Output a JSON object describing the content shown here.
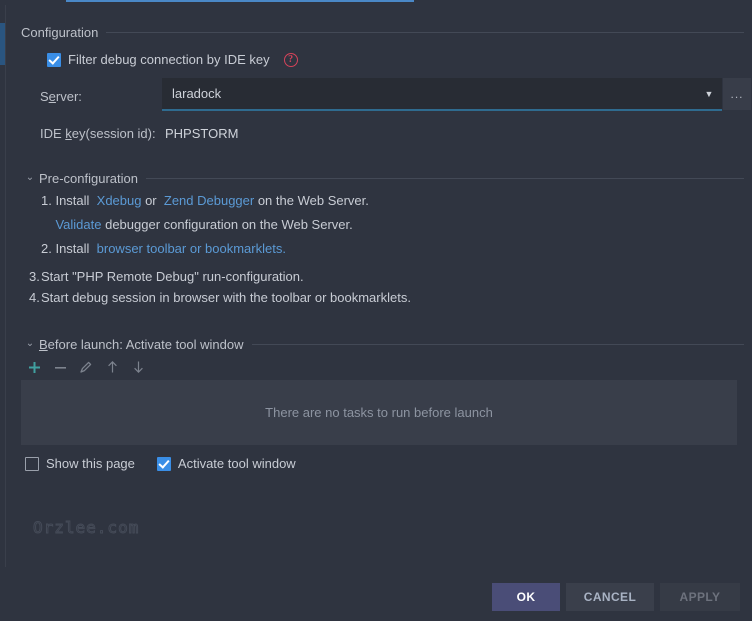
{
  "window": {
    "background_color": "#2f3440",
    "accent_blue": "#4a88c7",
    "link_color": "#5b9ad5"
  },
  "configuration_section": {
    "title": "Configuration",
    "filter_checkbox": {
      "label": "Filter debug connection by IDE key",
      "checked": true
    },
    "help_icon": "?",
    "server": {
      "label": "Server:",
      "label_underline_char": "e",
      "value": "laradock",
      "dropdown_arrow": "▼",
      "browse_button_label": "..."
    },
    "ide_key": {
      "label_part1": "IDE ",
      "label_underline_char": "k",
      "label_part2": "ey(session id):",
      "value": "PHPSTORM"
    }
  },
  "preconfiguration_section": {
    "title": "Pre-configuration",
    "chevron": "⌄",
    "lines": [
      {
        "number": "1.",
        "segments": [
          {
            "text": "Install ",
            "link": false
          },
          {
            "text": " Xdebug",
            "link": true
          },
          {
            "text": " or ",
            "link": false
          },
          {
            "text": " Zend Debugger",
            "link": true
          },
          {
            "text": " on the Web Server.",
            "link": false
          }
        ]
      },
      {
        "number": "",
        "segments": [
          {
            "text": "Validate",
            "link": true
          },
          {
            "text": " debugger configuration on the Web Server.",
            "link": false
          }
        ]
      },
      {
        "number": "2.",
        "segments": [
          {
            "text": "Install ",
            "link": false
          },
          {
            "text": " browser toolbar or bookmarklets.",
            "link": true
          }
        ]
      },
      {
        "number": "3.",
        "segments": [
          {
            "text": "Start \"PHP Remote Debug\" run-configuration.",
            "link": false
          }
        ]
      },
      {
        "number": "4.",
        "segments": [
          {
            "text": "Start debug session in browser with the toolbar or bookmarklets.",
            "link": false
          }
        ]
      }
    ]
  },
  "before_launch_section": {
    "title": "Before launch: Activate tool window",
    "title_underline_char": "B",
    "chevron": "⌄",
    "toolbar": [
      {
        "name": "add-task-button",
        "glyph": "+",
        "color": "#40a0a0"
      },
      {
        "name": "remove-task-button",
        "glyph": "−",
        "color": "#7d838e"
      },
      {
        "name": "edit-task-button",
        "glyph": "✎",
        "color": "#7d838e"
      },
      {
        "name": "move-up-button",
        "glyph": "↑",
        "color": "#7d838e"
      },
      {
        "name": "move-down-button",
        "glyph": "↓",
        "color": "#7d838e"
      }
    ],
    "empty_message": "There are no tasks to run before launch"
  },
  "bottom_options": [
    {
      "label": "Show this page",
      "checked": false
    },
    {
      "label": "Activate tool window",
      "checked": true
    }
  ],
  "watermark": "Orzlee.com",
  "buttons": {
    "ok": "OK",
    "cancel": "CANCEL",
    "apply": "APPLY"
  }
}
